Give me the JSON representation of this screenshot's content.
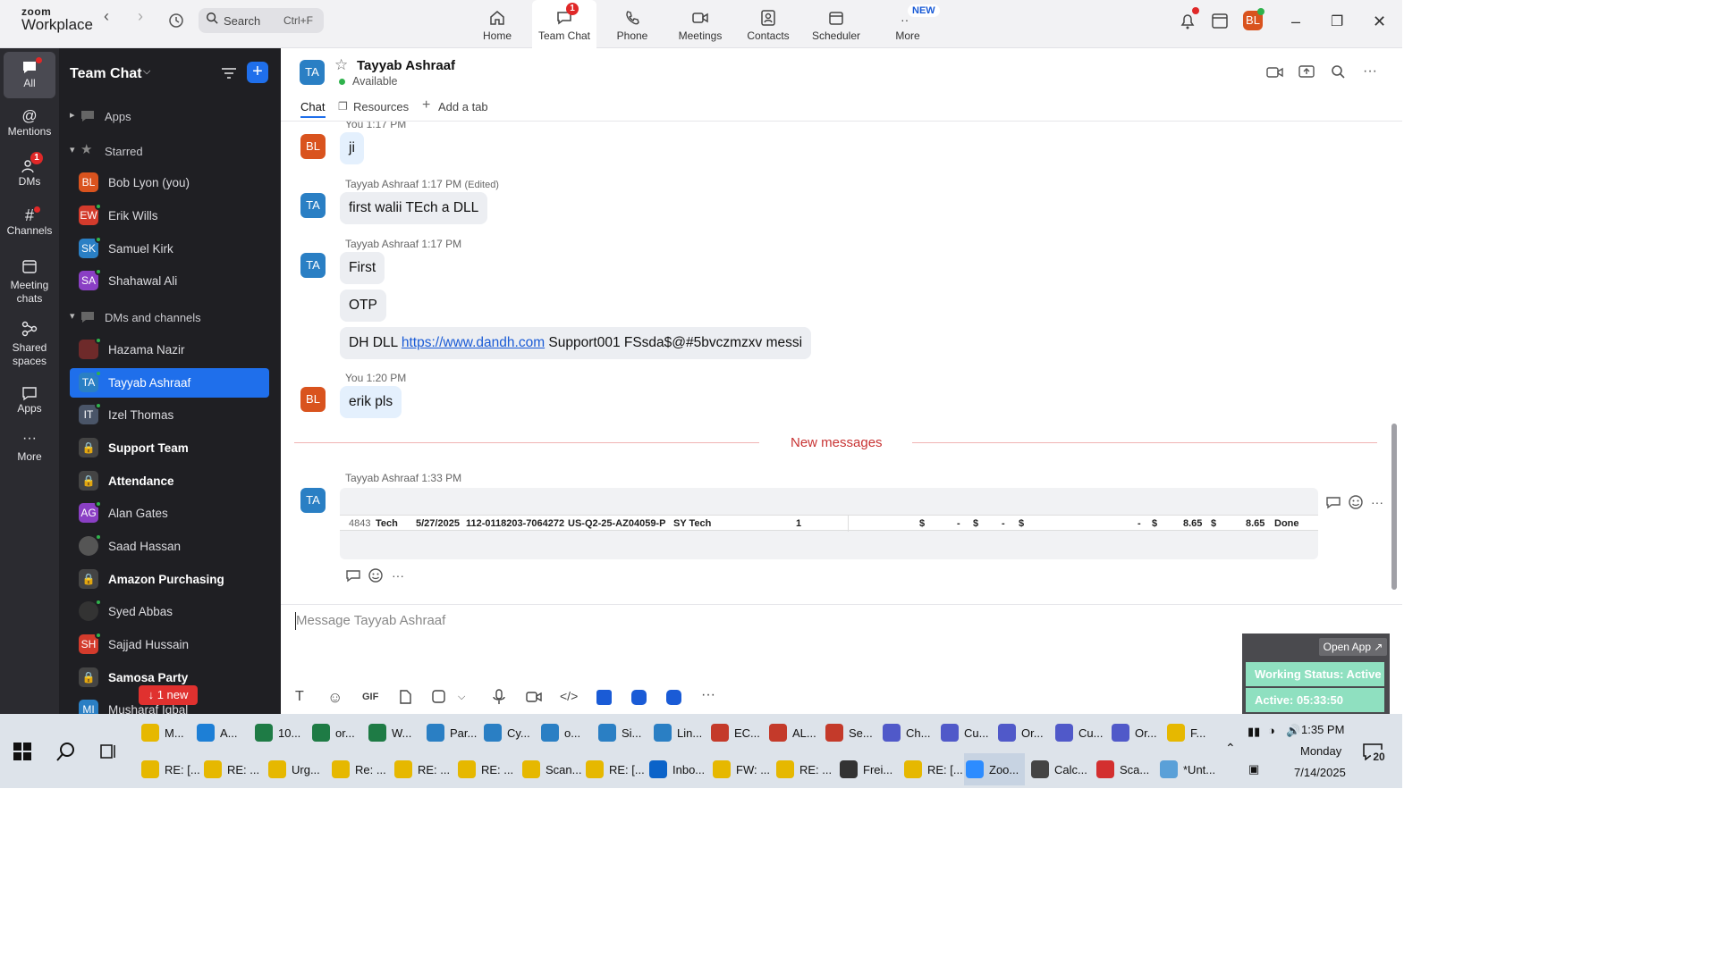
{
  "app": {
    "logo_top": "zoom",
    "logo_bottom": "Workplace",
    "search_label": "Search",
    "search_shortcut": "Ctrl+F"
  },
  "top_tabs": [
    {
      "label": "Home",
      "icon": "home-icon"
    },
    {
      "label": "Team Chat",
      "icon": "chat-icon",
      "badge": "1",
      "active": true
    },
    {
      "label": "Phone",
      "icon": "phone-icon"
    },
    {
      "label": "Meetings",
      "icon": "video-icon"
    },
    {
      "label": "Contacts",
      "icon": "contacts-icon"
    },
    {
      "label": "Scheduler",
      "icon": "calendar-icon"
    },
    {
      "label": "More",
      "icon": "more-icon",
      "badge": "NEW"
    }
  ],
  "user_avatar": "BL",
  "rail": [
    {
      "label": "All",
      "active": true
    },
    {
      "label": "Mentions"
    },
    {
      "label": "DMs",
      "badge": "1"
    },
    {
      "label": "Channels"
    },
    {
      "label": "Meeting chats"
    },
    {
      "label": "Shared spaces"
    },
    {
      "label": "Apps"
    },
    {
      "label": "More"
    }
  ],
  "sidebar": {
    "title": "Team Chat",
    "sections": {
      "apps": "Apps",
      "starred": "Starred",
      "dms": "DMs and channels"
    },
    "starred": [
      {
        "initials": "BL",
        "name": "Bob Lyon (you)",
        "color": "#d9531e"
      },
      {
        "initials": "EW",
        "name": "Erik Wills",
        "color": "#d33b2c"
      },
      {
        "initials": "SK",
        "name": "Samuel Kirk",
        "color": "#2a7fc4"
      },
      {
        "initials": "SA",
        "name": "Shahawal Ali",
        "color": "#8a3fc4"
      }
    ],
    "dms": [
      {
        "initials": "",
        "name": "Hazama Nazir",
        "color": "#6e2a2a"
      },
      {
        "initials": "TA",
        "name": "Tayyab Ashraaf",
        "color": "#2a7fc4",
        "selected": true
      },
      {
        "initials": "IT",
        "name": "Izel Thomas",
        "color": "#4a5568"
      },
      {
        "initials": "",
        "name": "Support Team",
        "bold": true,
        "locked": true
      },
      {
        "initials": "",
        "name": "Attendance",
        "bold": true,
        "locked": true
      },
      {
        "initials": "AG",
        "name": "Alan Gates",
        "color": "#8a3fc4"
      },
      {
        "initials": "",
        "name": "Saad Hassan",
        "color": "#555"
      },
      {
        "initials": "",
        "name": "Amazon Purchasing",
        "bold": true,
        "locked": true
      },
      {
        "initials": "",
        "name": "Syed Abbas",
        "color": "#444"
      },
      {
        "initials": "SH",
        "name": "Sajjad Hussain",
        "color": "#d33b2c"
      },
      {
        "initials": "",
        "name": "Samosa Party",
        "bold": true,
        "locked": true
      },
      {
        "initials": "MI",
        "name": "Musharaf Iqbal",
        "color": "#2a7fc4"
      }
    ],
    "new_pill": "↓ 1 new"
  },
  "chat": {
    "contact_initials": "TA",
    "contact_name": "Tayyab Ashraaf",
    "status": "Available",
    "tabs": [
      "Chat",
      "Resources",
      "Add a tab"
    ],
    "messages": {
      "m0_meta": "You 1:17 PM",
      "m0_text": "ji",
      "m1_meta_name": "Tayyab Ashraaf",
      "m1_meta_time": "1:17 PM",
      "m1_meta_edited": "(Edited)",
      "m1_text": "first walii TEch a DLL",
      "m2_meta_name": "Tayyab Ashraaf",
      "m2_meta_time": "1:17 PM",
      "m2_t1": "First",
      "m2_t2": "OTP",
      "m2_t3_pre": "DH DLL ",
      "m2_t3_link": "https://www.dandh.com",
      "m2_t3_post": " Support001 FSsda$@#5bvczmzxv messi",
      "m3_meta_name": "You",
      "m3_meta_time": "1:20 PM",
      "m3_text": "erik pls",
      "new_messages": "New messages",
      "m4_meta_name": "Tayyab Ashraaf",
      "m4_meta_time": "1:33 PM"
    },
    "table_row": [
      "4843",
      "Tech",
      "5/27/2025",
      "112-0118203-7064272",
      "US-Q2-25-AZ04059-P",
      "SY Tech",
      "1",
      "",
      "$",
      "-",
      "$",
      "-",
      "$",
      "-",
      "$",
      "8.65",
      "$",
      "8.65",
      "Done"
    ],
    "composer_placeholder": "Message Tayyab Ashraaf",
    "composer_tools": [
      "T",
      "☺",
      "GIF"
    ]
  },
  "status_widget": {
    "open_app": "Open App ↗",
    "working_status": "Working Status: Active",
    "active_timer": "Active: 05:33:50"
  },
  "taskbar": {
    "row1": [
      {
        "label": "M...",
        "color": "#e6b800"
      },
      {
        "label": "A...",
        "color": "#1d7fd6"
      },
      {
        "label": "10...",
        "color": "#1e7b45"
      },
      {
        "label": "or...",
        "color": "#1e7b45"
      },
      {
        "label": "W...",
        "color": "#1e7b45"
      },
      {
        "label": "Par...",
        "color": "#2a7fc4"
      },
      {
        "label": "Cy...",
        "color": "#2a7fc4"
      },
      {
        "label": "o...",
        "color": "#2a7fc4"
      },
      {
        "label": "Si...",
        "color": "#2a7fc4"
      },
      {
        "label": "Lin...",
        "color": "#2a7fc4"
      },
      {
        "label": "EC...",
        "color": "#c43a2a"
      },
      {
        "label": "AL...",
        "color": "#c43a2a"
      },
      {
        "label": "Se...",
        "color": "#c43a2a"
      },
      {
        "label": "Ch...",
        "color": "#5059c9"
      },
      {
        "label": "Cu...",
        "color": "#5059c9"
      },
      {
        "label": "Or...",
        "color": "#5059c9"
      },
      {
        "label": "Cu...",
        "color": "#5059c9"
      },
      {
        "label": "Or...",
        "color": "#5059c9"
      },
      {
        "label": "F...",
        "color": "#e6b800"
      }
    ],
    "row2": [
      {
        "label": "RE: [...",
        "color": "#e6b800"
      },
      {
        "label": "RE: ...",
        "color": "#e6b800"
      },
      {
        "label": "Urg...",
        "color": "#e6b800"
      },
      {
        "label": "Re: ...",
        "color": "#e6b800"
      },
      {
        "label": "RE: ...",
        "color": "#e6b800"
      },
      {
        "label": "RE: ...",
        "color": "#e6b800"
      },
      {
        "label": "Scan...",
        "color": "#e6b800"
      },
      {
        "label": "RE: [...",
        "color": "#e6b800"
      },
      {
        "label": "Inbo...",
        "color": "#0b63c9"
      },
      {
        "label": "FW: ...",
        "color": "#e6b800"
      },
      {
        "label": "RE: ...",
        "color": "#e6b800"
      },
      {
        "label": "Frei...",
        "color": "#333"
      },
      {
        "label": "RE: [...",
        "color": "#e6b800"
      },
      {
        "label": "Zoo...",
        "color": "#2d8cff",
        "active": true
      },
      {
        "label": "Calc...",
        "color": "#444"
      },
      {
        "label": "Sca...",
        "color": "#d32f2f"
      },
      {
        "label": "*Unt...",
        "color": "#5aa0d8"
      }
    ],
    "time": "1:35 PM",
    "day": "Monday",
    "date": "7/14/2025",
    "notif_count": "20"
  }
}
